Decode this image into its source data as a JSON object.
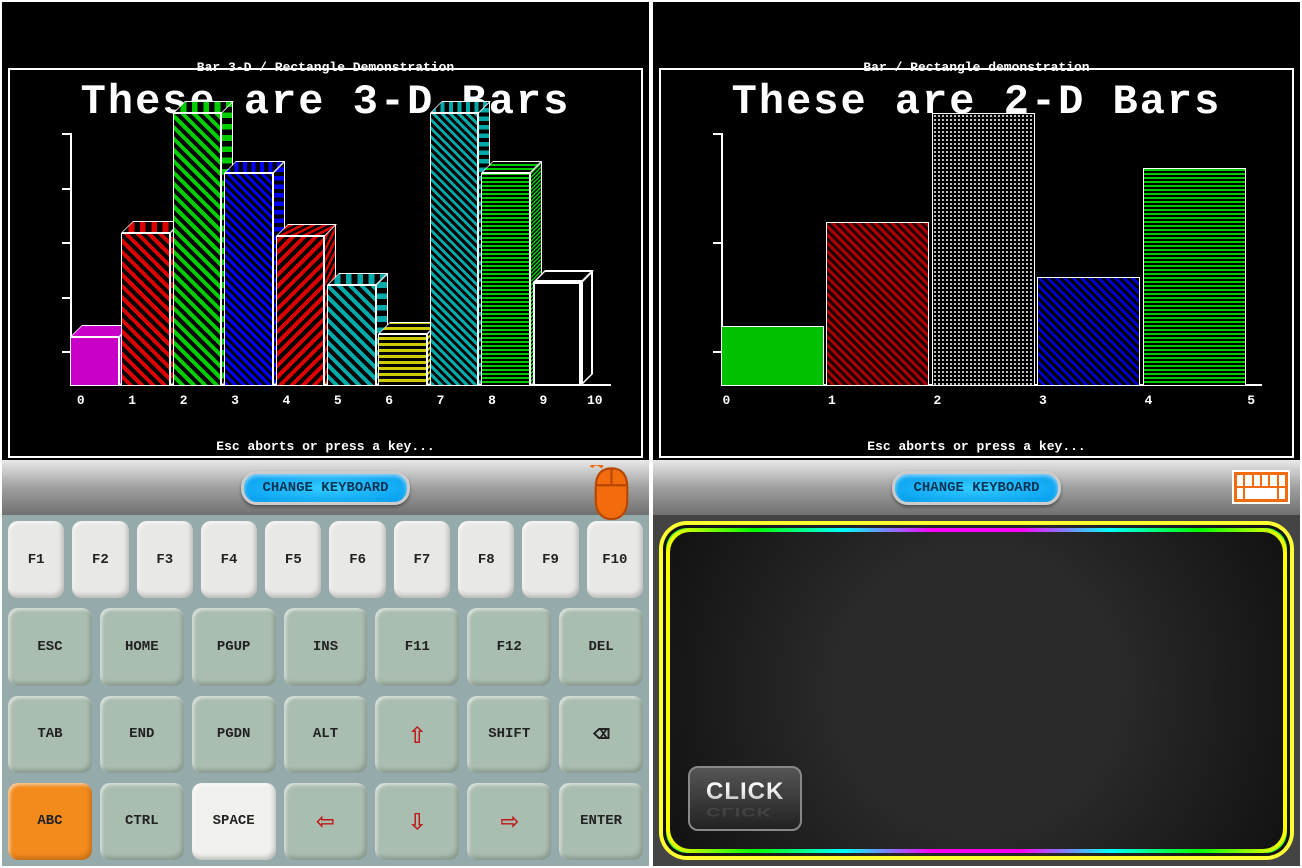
{
  "left": {
    "subtitle": "Bar 3-D / Rectangle Demonstration",
    "title": "These are 3-D Bars",
    "footer": "Esc aborts or press a key...",
    "change_kb": "CHANGE KEYBOARD",
    "xticks": [
      "0",
      "1",
      "2",
      "3",
      "4",
      "5",
      "6",
      "7",
      "8",
      "9",
      "10"
    ]
  },
  "right": {
    "subtitle": "Bar / Rectangle demonstration",
    "title": "These are 2-D Bars",
    "footer": "Esc aborts or press a key...",
    "change_kb": "CHANGE KEYBOARD",
    "xticks": [
      "0",
      "1",
      "2",
      "3",
      "4",
      "5"
    ]
  },
  "keyboard": {
    "row1": [
      "F1",
      "F2",
      "F3",
      "F4",
      "F5",
      "F6",
      "F7",
      "F8",
      "F9",
      "F10"
    ],
    "row2": [
      "ESC",
      "HOME",
      "PGUP",
      "INS",
      "F11",
      "F12",
      "DEL"
    ],
    "row3": [
      "TAB",
      "END",
      "PGDN",
      "ALT",
      "↑",
      "SHIFT",
      "⌫"
    ],
    "row4": [
      "ABC",
      "CTRL",
      "SPACE",
      "←",
      "↓",
      "→",
      "ENTER"
    ]
  },
  "trackpad": {
    "click": "CLICK"
  },
  "chart_data": [
    {
      "type": "bar",
      "title": "These are 3-D Bars",
      "subtitle": "Bar 3-D / Rectangle Demonstration",
      "style": "3d",
      "y_ticks": 5,
      "categories": [
        "0",
        "1",
        "2",
        "3",
        "4",
        "5",
        "6",
        "7",
        "8",
        "9",
        "10"
      ],
      "series": [
        {
          "x": 0,
          "value": 18,
          "pattern": "solid",
          "color": "#c800c8"
        },
        {
          "x": 1,
          "value": 56,
          "pattern": "diagonal",
          "color": "#d00000"
        },
        {
          "x": 2,
          "value": 100,
          "pattern": "diagonal",
          "color": "#00c000"
        },
        {
          "x": 3,
          "value": 78,
          "pattern": "crosshatch",
          "color": "#0000ff"
        },
        {
          "x": 4,
          "value": 55,
          "pattern": "back-diagonal",
          "color": "#d00000"
        },
        {
          "x": 5,
          "value": 37,
          "pattern": "diagonal",
          "color": "#00aaaa"
        },
        {
          "x": 6,
          "value": 19,
          "pattern": "grid",
          "color": "#cccc00"
        },
        {
          "x": 7,
          "value": 100,
          "pattern": "crosshatch",
          "color": "#00aaaa"
        },
        {
          "x": 8,
          "value": 78,
          "pattern": "horizontal-hatch",
          "color": "#00c000"
        },
        {
          "x": 9,
          "value": 38,
          "pattern": "outline",
          "color": "#ffffff"
        }
      ],
      "ylim": [
        0,
        100
      ]
    },
    {
      "type": "bar",
      "title": "These are 2-D Bars",
      "subtitle": "Bar / Rectangle demonstration",
      "style": "2d",
      "y_ticks": 3,
      "categories": [
        "0",
        "1",
        "2",
        "3",
        "4",
        "5"
      ],
      "series": [
        {
          "x": 0,
          "value": 22,
          "pattern": "solid",
          "color": "#00c000"
        },
        {
          "x": 1,
          "value": 60,
          "pattern": "diagonal",
          "color": "#a00000"
        },
        {
          "x": 2,
          "value": 100,
          "pattern": "dots",
          "color": "#ffffff"
        },
        {
          "x": 3,
          "value": 40,
          "pattern": "diagonal",
          "color": "#0000cc"
        },
        {
          "x": 4,
          "value": 80,
          "pattern": "horizontal-hatch",
          "color": "#00c000"
        }
      ],
      "ylim": [
        0,
        100
      ]
    }
  ]
}
